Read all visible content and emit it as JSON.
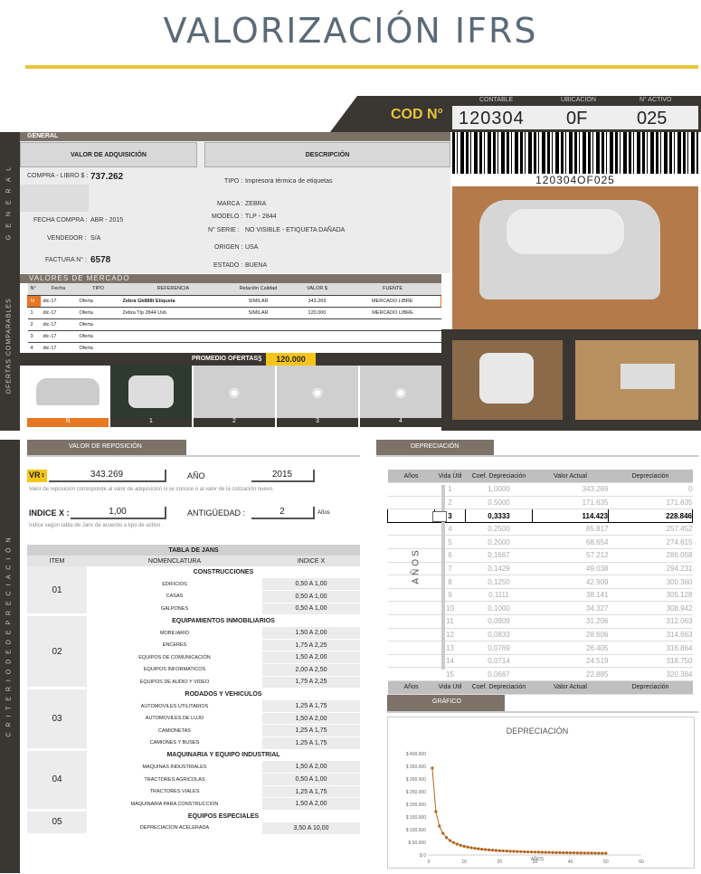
{
  "page": {
    "title": "VALORIZACIÓN IFRS"
  },
  "code": {
    "label": "COD N°",
    "contable_label": "CONTABLE",
    "ubicacion_label": "UBICACIÓN",
    "activo_label": "N° ACTIVO",
    "contable": "120304",
    "ubicacion": "0F",
    "activo": "025",
    "barcode_text": "120304OF025"
  },
  "general": {
    "section": "GENERAL",
    "side": "G E N E R A L",
    "valor_title": "VALOR DE ADQUISICIÓN",
    "desc_title": "DESCRIPCIÓN",
    "compra_label": "COMPRA - LIBRO $ :",
    "compra": "737.262",
    "fecha_label": "FECHA COMPRA :",
    "fecha": "ABR - 2015",
    "vendedor_label": "VENDEDOR :",
    "vendedor": "S/A",
    "factura_label": "FACTURA N° :",
    "factura": "6578",
    "tipo_label": "TIPO :",
    "tipo": "Impresora térmica de etiquetas",
    "marca_label": "MARCA :",
    "marca": "ZEBRA",
    "modelo_label": "MODELO :",
    "modelo": "TLP - 2844",
    "serie_label": "N° SERIE :",
    "serie": "NO VISIBLE - ETIQUETA DAÑADA",
    "origen_label": "ORIGEN :",
    "origen": "USA",
    "estado_label": "ESTADO :",
    "estado": "BUENA"
  },
  "market": {
    "section": "VALORES DE MERCADO",
    "side": "OFERTAS COMPARABLES",
    "headers": [
      "N°",
      "Fecha",
      "TIPO",
      "REFERENCIA",
      "Relación Calidad",
      "VALOR $",
      "FUENTE"
    ],
    "rows": [
      [
        "N",
        "dic-17",
        "Oferta",
        "Zebra Gk888t Etiqueta",
        "SIMILAR",
        "343.269",
        "MERCADO LIBRE"
      ],
      [
        "1",
        "dic-17",
        "Oferta",
        "Zebra Tlp 2844 Usb",
        "SIMILAR",
        "120.000",
        "MERCADO LIBRE"
      ],
      [
        "2",
        "dic-17",
        "Oferta",
        "",
        "",
        "",
        ""
      ],
      [
        "3",
        "dic-17",
        "Oferta",
        "",
        "",
        "",
        ""
      ],
      [
        "4",
        "dic-17",
        "Oferta",
        "",
        "",
        "",
        ""
      ]
    ],
    "avg_label": "PROMEDIO OFERTAS",
    "avg_currency": "$",
    "avg": "120.000",
    "thumbs": [
      "N",
      "1",
      "2",
      "3",
      "4"
    ]
  },
  "reposicion": {
    "section": "VALOR DE REPOSICIÓN",
    "vr_label": "VR",
    "vr_cur": "$",
    "vr": "343.269",
    "anio_label": "AÑO",
    "anio": "2015",
    "note": "Valor de reposición corresponde al valor de adquisición si se conoce o al valor de la cotización nuevo.",
    "indice_label": "INDICE X :",
    "indice": "1,00",
    "antig_label": "ANTIGÜEDAD :",
    "antig": "2",
    "anios": "Años",
    "indice_note": "Indice según tabla de Jans de acuerdo a tipo de activo .",
    "side": "C R I T E R I O   D E   D E P R E C I A C I Ó N"
  },
  "jans": {
    "title": "TABLA DE JANS",
    "h_item": "ITEM",
    "h_nom": "NOMENCLATURA",
    "h_idx": "INDICE X",
    "groups": [
      {
        "item": "01",
        "name": "CONSTRUCCIONES",
        "rows": [
          [
            "EDIFICIOS",
            "0,50  A  1,00"
          ],
          [
            "CASAS",
            "0,50  A  1,00"
          ],
          [
            "GALPONES",
            "0,50  A  1,00"
          ]
        ]
      },
      {
        "item": "02",
        "name": "EQUIPAMIENTOS INMOBILIARIOS",
        "rows": [
          [
            "MOBILIARIO",
            "1,50  A  2,00"
          ],
          [
            "ENCERES",
            "1,75  A  2,25"
          ],
          [
            "EQUIPOS DE COMUNICACIÓN",
            "1,50  A  2,00"
          ],
          [
            "EQUIPOS INFORMATICOS",
            "2,00  A  2,50"
          ],
          [
            "EQUIPOS DE AUDIO Y VIDEO",
            "1,75  A  2,25"
          ]
        ]
      },
      {
        "item": "03",
        "name": "RODADOS Y VEHICULOS",
        "rows": [
          [
            "AUTOMOVILES UTILITARIOS",
            "1,25  A  1,75"
          ],
          [
            "AUTOMOVILES DE LUJO",
            "1,50  A  2,00"
          ],
          [
            "CAMIONETAS",
            "1,25  A  1,75"
          ],
          [
            "CAMIONES Y BUSES",
            "1,25  A  1,75"
          ]
        ]
      },
      {
        "item": "04",
        "name": "MAQUINARIA Y EQUIPO INDUSTRIAL",
        "rows": [
          [
            "MAQUINAS INDUSTRIALES",
            "1,50  A  2,00"
          ],
          [
            "TRACTORES AGRICOLAS",
            "0,50  A  1,00"
          ],
          [
            "TRACTORES VIALES",
            "1,25  A  1,75"
          ],
          [
            "MAQUINARIA PARA CONSTRUCCION",
            "1,50  A  2,00"
          ]
        ]
      },
      {
        "item": "05",
        "name": "EQUIPOS ESPECIALES",
        "rows": [
          [
            "DEPRECIACION ACELERADA",
            "3,50  A  10,00"
          ]
        ]
      }
    ]
  },
  "depreciacion": {
    "section": "DEPRECIACIÓN",
    "h": [
      "Años",
      "Vida Útil",
      "Coef. Depreciación",
      "Valor Actual",
      "Depreciación"
    ],
    "side": "AÑOS",
    "rows": [
      [
        "1",
        "1,0000",
        "343.269",
        "0"
      ],
      [
        "2",
        "0,5000",
        "171.635",
        "171.635"
      ],
      [
        "3",
        "0,3333",
        "114.423",
        "228.846"
      ],
      [
        "4",
        "0,2500",
        "85.817",
        "257.452"
      ],
      [
        "5",
        "0,2000",
        "68.654",
        "274.615"
      ],
      [
        "6",
        "0,1667",
        "57.212",
        "286.058"
      ],
      [
        "7",
        "0,1429",
        "49.038",
        "294.231"
      ],
      [
        "8",
        "0,1250",
        "42.909",
        "300.360"
      ],
      [
        "9",
        "0,1111",
        "38.141",
        "305.128"
      ],
      [
        "10",
        "0,1000",
        "34.327",
        "308.942"
      ],
      [
        "11",
        "0,0909",
        "31.206",
        "312.063"
      ],
      [
        "12",
        "0,0833",
        "28.606",
        "314.663"
      ],
      [
        "13",
        "0,0769",
        "26.405",
        "316.864"
      ],
      [
        "14",
        "0,0714",
        "24.519",
        "318.750"
      ],
      [
        "15",
        "0,0667",
        "22.885",
        "320.384"
      ]
    ],
    "selected": 2
  },
  "grafico": {
    "section": "GRÁFICO"
  },
  "chart_data": {
    "type": "line",
    "title": "DEPRECIACIÓN",
    "xlabel": "AÑOS",
    "ylabel": "",
    "xlim": [
      0,
      60
    ],
    "ylim": [
      0,
      400000
    ],
    "yticks": [
      "$ 0",
      "$ 50.000",
      "$ 100.000",
      "$ 150.000",
      "$ 200.000",
      "$ 250.000",
      "$ 300.000",
      "$ 350.000",
      "$ 400.000"
    ],
    "xticks": [
      "0",
      "10",
      "20",
      "30",
      "40",
      "50",
      "60"
    ],
    "series": [
      {
        "values": [
          [
            1,
            343269
          ],
          [
            2,
            171635
          ],
          [
            3,
            114423
          ],
          [
            4,
            85817
          ],
          [
            5,
            68654
          ],
          [
            6,
            57212
          ],
          [
            7,
            49038
          ],
          [
            8,
            42909
          ],
          [
            9,
            38141
          ],
          [
            10,
            34327
          ],
          [
            11,
            31206
          ],
          [
            12,
            28606
          ],
          [
            13,
            26405
          ],
          [
            14,
            24519
          ],
          [
            15,
            22885
          ],
          [
            16,
            21454
          ],
          [
            17,
            20192
          ],
          [
            18,
            19071
          ],
          [
            19,
            18067
          ],
          [
            20,
            17163
          ],
          [
            21,
            16346
          ],
          [
            22,
            15603
          ],
          [
            23,
            14925
          ],
          [
            24,
            14303
          ],
          [
            25,
            13731
          ],
          [
            26,
            13203
          ],
          [
            27,
            12714
          ],
          [
            28,
            12260
          ],
          [
            29,
            11837
          ],
          [
            30,
            11442
          ],
          [
            31,
            11073
          ],
          [
            32,
            10727
          ],
          [
            33,
            10402
          ],
          [
            34,
            10096
          ],
          [
            35,
            9808
          ],
          [
            36,
            9535
          ],
          [
            37,
            9277
          ],
          [
            38,
            9033
          ],
          [
            39,
            8802
          ],
          [
            40,
            8582
          ],
          [
            41,
            8372
          ],
          [
            42,
            8173
          ],
          [
            43,
            7983
          ],
          [
            44,
            7802
          ],
          [
            45,
            7628
          ],
          [
            46,
            7462
          ],
          [
            47,
            7304
          ],
          [
            48,
            7151
          ],
          [
            49,
            7005
          ],
          [
            50,
            6865
          ]
        ]
      }
    ],
    "line_color": "#b5651d"
  }
}
